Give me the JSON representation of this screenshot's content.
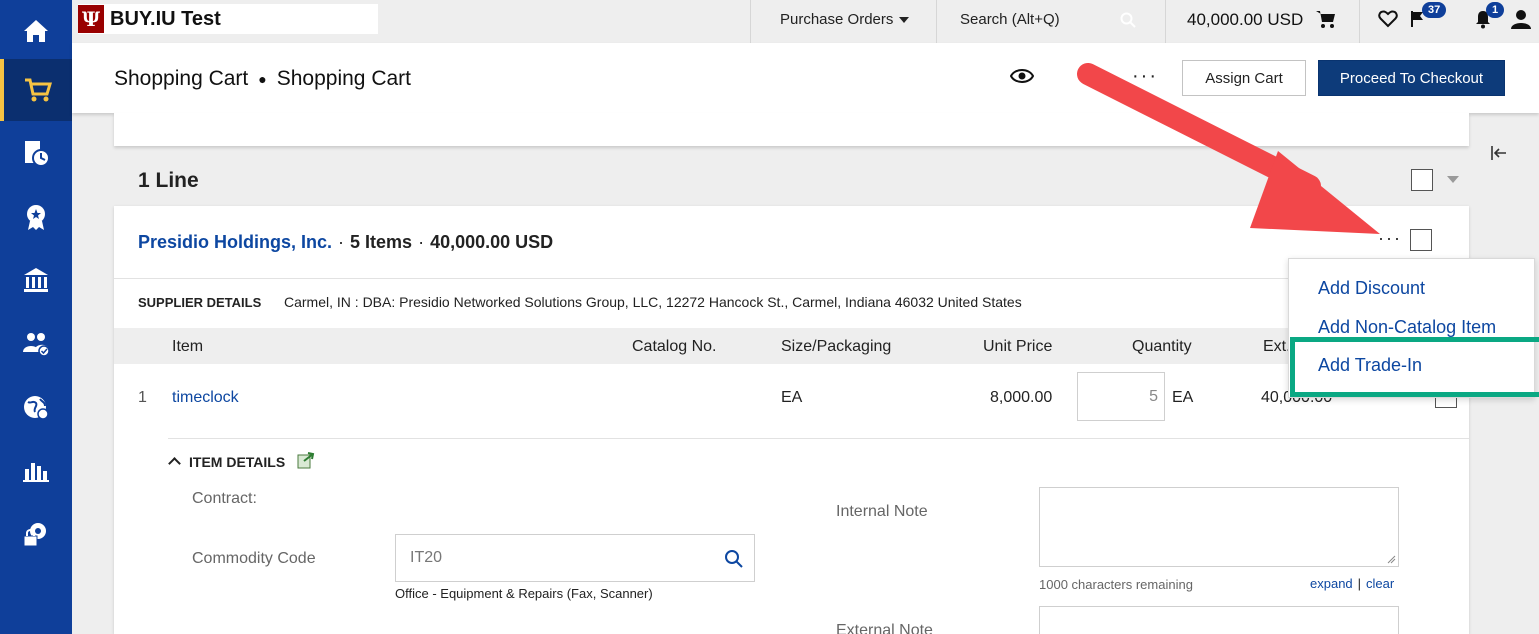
{
  "app": {
    "logo_letter": "Ψ",
    "brand_name": "BUY.IU Test"
  },
  "rail": {
    "items": [
      {
        "icon": "home-icon"
      },
      {
        "icon": "cart-icon",
        "active": true
      },
      {
        "icon": "orders-clock-icon"
      },
      {
        "icon": "badge-icon"
      },
      {
        "icon": "bank-icon"
      },
      {
        "icon": "people-icon"
      },
      {
        "icon": "globe-icon"
      },
      {
        "icon": "chart-icon"
      },
      {
        "icon": "gear-lock-icon"
      }
    ]
  },
  "topbar": {
    "purchase_orders": "Purchase Orders",
    "search_placeholder": "Search (Alt+Q)",
    "cart_total": "40,000.00 USD",
    "flag_count": "37",
    "bell_count": "1"
  },
  "header": {
    "crumb_1": "Shopping Cart",
    "crumb_2": "Shopping Cart",
    "more": "···",
    "assign_cart": "Assign Cart",
    "proceed": "Proceed To Checkout"
  },
  "lines": {
    "title": "1 Line"
  },
  "supplier": {
    "name": "Presidio Holdings, Inc.",
    "items": "5 Items",
    "total": "40,000.00 USD",
    "more": "···",
    "details_label": "SUPPLIER DETAILS",
    "details_value": "Carmel, IN : DBA: Presidio Networked Solutions Group, LLC, 12272 Hancock St., Carmel, Indiana 46032 United States"
  },
  "table": {
    "headers": {
      "item": "Item",
      "catalog": "Catalog No.",
      "size": "Size/Packaging",
      "unit_price": "Unit Price",
      "quantity": "Quantity",
      "ext": "Ext."
    },
    "rows": [
      {
        "num": "1",
        "item": "timeclock",
        "size": "EA",
        "unit_price": "8,000.00",
        "quantity": "5",
        "uom": "EA",
        "ext": "40,000.00"
      }
    ]
  },
  "item_details": {
    "toggle": "ITEM DETAILS",
    "contract_label": "Contract:",
    "commodity_label": "Commodity Code",
    "commodity_value": "IT20",
    "commodity_desc": "Office - Equipment & Repairs (Fax, Scanner)",
    "internal_note_label": "Internal Note",
    "chars_remaining": "1000 characters remaining",
    "expand": "expand",
    "clear": "clear",
    "external_note_label": "External Note"
  },
  "menu": {
    "items": [
      "Add Discount",
      "Add Non-Catalog Item",
      "Add Trade-In"
    ]
  },
  "colors": {
    "rail": "#0f3f9a",
    "primary": "#0d3b7a",
    "link": "#0d47a1",
    "highlight": "#0aa883",
    "arrow": "#f2474a"
  }
}
